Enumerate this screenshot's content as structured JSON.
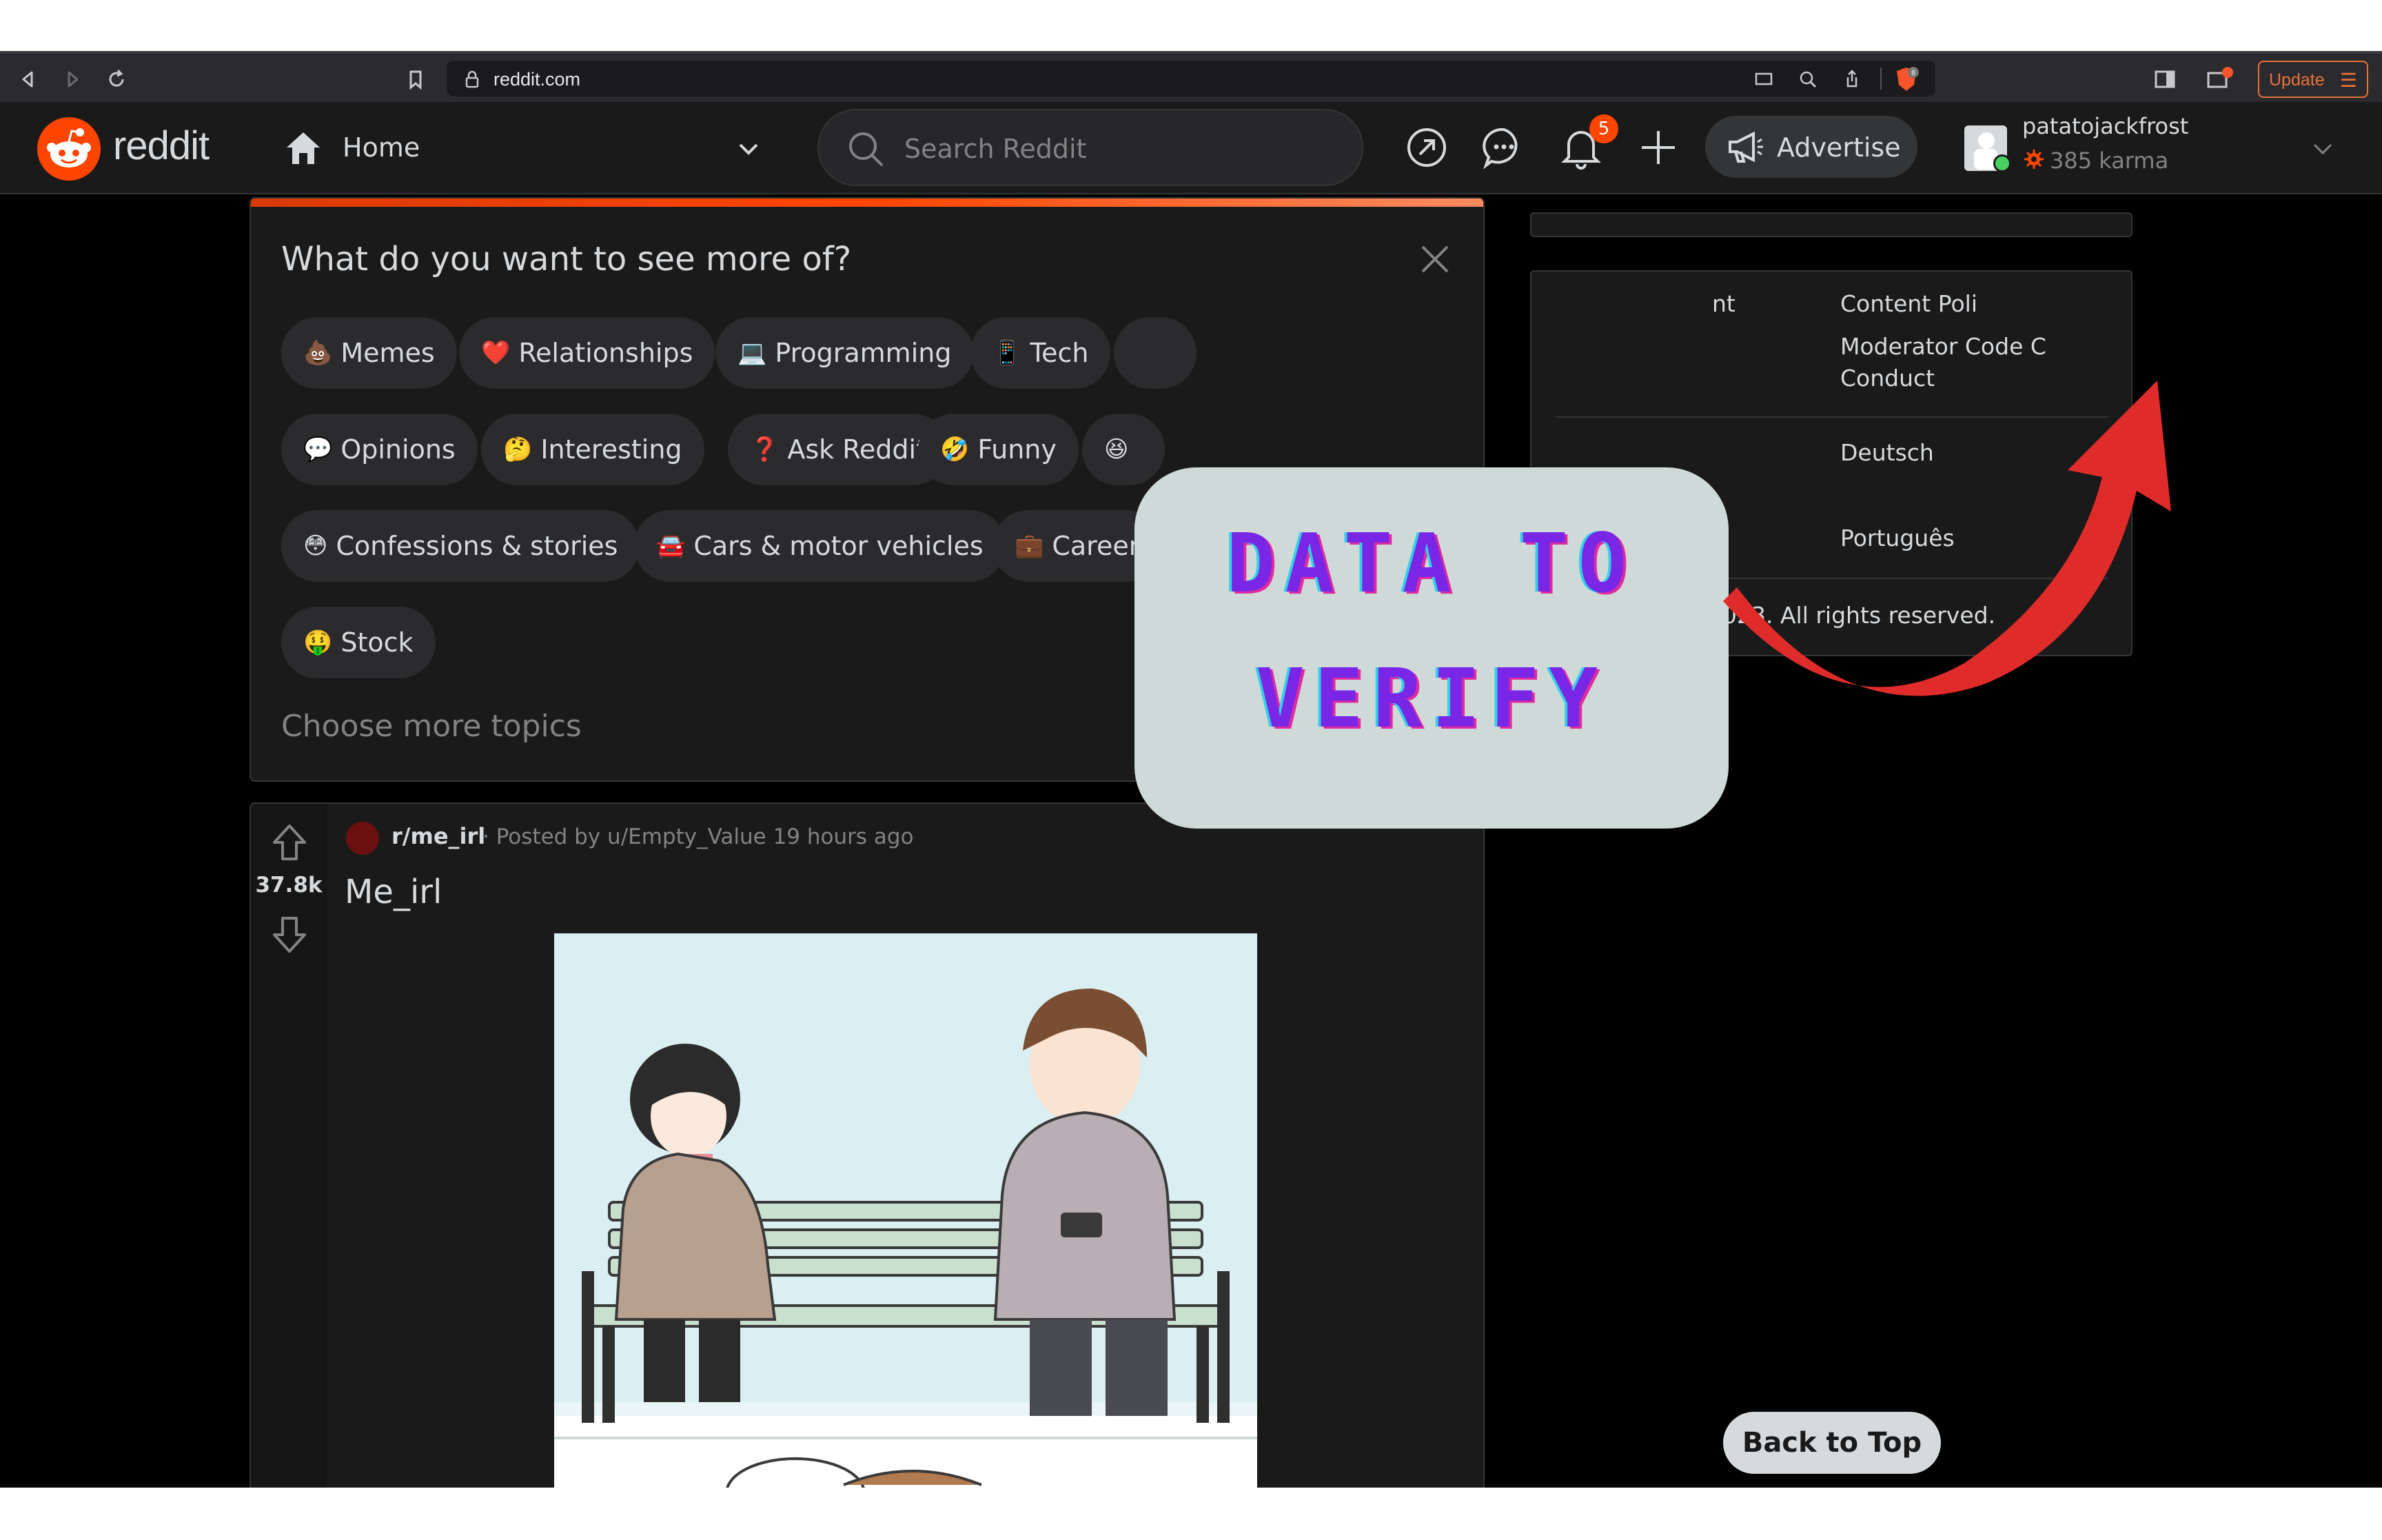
{
  "browser": {
    "url": "reddit.com",
    "update_label": "Update",
    "brave_badge": "8"
  },
  "header": {
    "logo_text": "reddit",
    "feed_label": "Home",
    "search_placeholder": "Search Reddit",
    "notification_count": "5",
    "advertise_label": "Advertise",
    "username": "patatojackfrost",
    "karma": "385 karma"
  },
  "topics": {
    "title": "What do you want to see more of?",
    "chips": [
      {
        "emoji": "💩",
        "label": "Memes"
      },
      {
        "emoji": "❤️",
        "label": "Relationships"
      },
      {
        "emoji": "💻",
        "label": "Programming"
      },
      {
        "emoji": "📱",
        "label": "Tech"
      },
      {
        "emoji": "💬",
        "label": "Opinions"
      },
      {
        "emoji": "🤔",
        "label": "Interesting"
      },
      {
        "emoji": "❓",
        "label": "Ask Reddit"
      },
      {
        "emoji": "🤣",
        "label": "Funny"
      },
      {
        "emoji": "😳",
        "label": "Confessions & stories"
      },
      {
        "emoji": "🚘",
        "label": "Cars & motor vehicles"
      },
      {
        "emoji": "💼",
        "label": "Career"
      },
      {
        "emoji": "🤑",
        "label": "Stock"
      }
    ],
    "more_label": "Choose more topics"
  },
  "sidebar": {
    "link_agreement_fragment": "nt",
    "link_content_policy": "Content Poli",
    "link_moderator_code": "Moderator Code C",
    "link_conduct": "Conduct",
    "lang_deutsch": "Deutsch",
    "lang_portugues": "Português",
    "copyright": "2023. All rights reserved."
  },
  "post": {
    "votes": "37.8k",
    "subreddit": "r/me_irl",
    "meta": "· Posted by u/Empty_Value 19 hours ago",
    "title": "Me_irl"
  },
  "overlay": {
    "line1": "DATA TO",
    "line2": "VERIFY",
    "arrow_color": "#e02b2b"
  },
  "back_to_top": "Back to Top",
  "colors": {
    "accent": "#ff4500",
    "background": "#1a1a1b",
    "page": "#000000"
  }
}
